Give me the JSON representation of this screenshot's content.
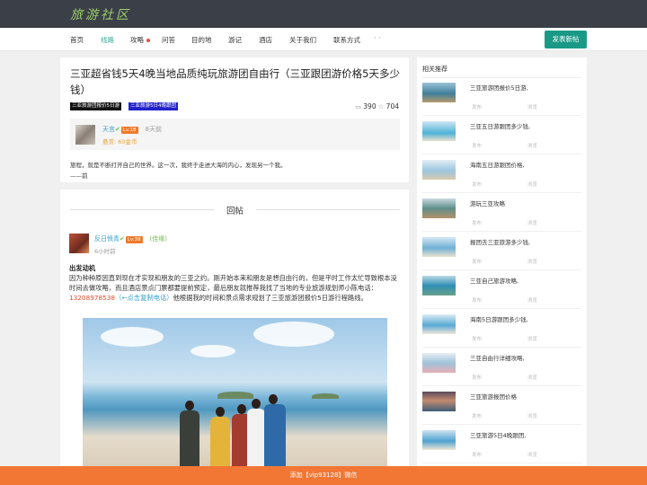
{
  "header": {
    "logo": "旅游社区"
  },
  "nav": {
    "items": [
      {
        "label": "首页"
      },
      {
        "label": "线路"
      },
      {
        "label": "攻略"
      },
      {
        "label": "问答"
      },
      {
        "label": "目的地"
      },
      {
        "label": "游记"
      },
      {
        "label": "酒店"
      },
      {
        "label": "关于我们"
      },
      {
        "label": "联系方式"
      }
    ],
    "post_button": "发表新帖"
  },
  "article": {
    "title": "三亚超省钱5天4晚当地品质纯玩旅游团自由行（三亚跟团游价格5天多少钱）",
    "tags": [
      "三亚旅游团报价5日游",
      "三亚旅游5日4晚跟团"
    ],
    "comments": "390",
    "favorites": "704",
    "author": {
      "name": "天言",
      "level": "Lv.18",
      "time": "8天前",
      "reward": "悬赏: 60金币"
    },
    "excerpt_1": "旅程，就是不断打开自己的世界。这一次，我终于走进大海的内心，发现另一个我。",
    "excerpt_2": "——前"
  },
  "replies": {
    "heading": "回帖",
    "user": {
      "name": "反日愤青",
      "level": "Lv.39",
      "role": "(佳缘)",
      "time": "6小时前"
    },
    "section_title": "出发动机",
    "body_1": "因为种种原因直到现在才实现和朋友的三亚之约。刚开始本来和朋友是想自由行的，但是平时工作太忙导致根本没时间去做攻略，而且酒店景点门票都要提前预定，最后朋友就推荐我找了当地的专业旅游规划师小陈电话：",
    "phone": "13208978538",
    "copy_hint": "（←点击复制电话）",
    "body_2": "他根据我的时间和景点需求规划了三亚旅游团报价5日游行程路线。"
  },
  "sidebar": {
    "title": "相关推荐",
    "items": [
      {
        "title": "三亚旅游团报价5日游,",
        "meta1": "发布",
        "meta2": "浏览"
      },
      {
        "title": "三亚五日游跟团多少钱,",
        "meta1": "发布",
        "meta2": "浏览"
      },
      {
        "title": "海南五日游跟团价格,",
        "meta1": "发布",
        "meta2": "浏览"
      },
      {
        "title": "游玩三亚攻略",
        "meta1": "发布",
        "meta2": "浏览"
      },
      {
        "title": "报团去三亚旅游多少钱,",
        "meta1": "发布",
        "meta2": "浏览"
      },
      {
        "title": "三亚自己旅游攻略,",
        "meta1": "发布",
        "meta2": "浏览"
      },
      {
        "title": "海南5日游跟团多少钱,",
        "meta1": "发布",
        "meta2": "浏览"
      },
      {
        "title": "三亚自由行详细攻略,",
        "meta1": "发布",
        "meta2": "浏览"
      },
      {
        "title": "三亚旅游报团价格",
        "meta1": "发布",
        "meta2": "浏览"
      },
      {
        "title": "三亚旅游5日4晚跟团,",
        "meta1": "发布",
        "meta2": "浏览"
      }
    ]
  },
  "footer": {
    "text": "添加【vip93128】微信"
  }
}
